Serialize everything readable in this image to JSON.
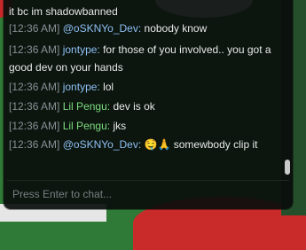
{
  "chat": {
    "messages": [
      {
        "ts": "",
        "user": "",
        "text": "it bc im shadowbanned",
        "color": ""
      },
      {
        "ts": "[12:36 AM]",
        "user": "@oSKNYo_Dev:",
        "text": "nobody know",
        "color": "blue"
      },
      {
        "ts": "[12:36 AM]",
        "user": "jontype:",
        "text": "for those of you involved.. you got a good dev on your hands",
        "color": "blue"
      },
      {
        "ts": "[12:36 AM]",
        "user": "jontype:",
        "text": "lol",
        "color": "blue"
      },
      {
        "ts": "[12:36 AM]",
        "user": "Lil Pengu:",
        "text": "dev is ok",
        "color": "green"
      },
      {
        "ts": "[12:36 AM]",
        "user": "Lil Pengu:",
        "text": "jks",
        "color": "green"
      },
      {
        "ts": "[12:36 AM]",
        "user": "@oSKNYo_Dev:",
        "emoji": "🤤🙏",
        "text": "somewbody clip it",
        "color": "blue"
      }
    ],
    "input": {
      "placeholder": "Press Enter to chat..."
    },
    "colors": {
      "user_blue": "#8fbff3",
      "user_green": "#7ddc7f",
      "timestamp": "#8a8f96",
      "panel": "#0a0e0c"
    }
  }
}
